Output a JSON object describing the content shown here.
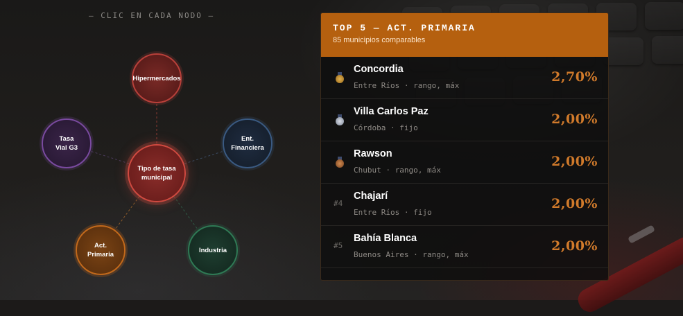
{
  "hint": "— CLIC EN CADA NODO —",
  "graph": {
    "center": {
      "label": "Tipo de tasa municipal"
    },
    "nodes": [
      {
        "key": "hiper",
        "label": "Hipermercados",
        "color": "#b8403a"
      },
      {
        "key": "ent",
        "label": "Ent. Financiera",
        "color": "#2e4a6e"
      },
      {
        "key": "ind",
        "label": "Industria",
        "color": "#2f7a55"
      },
      {
        "key": "act",
        "label": "Act. Primaria",
        "color": "#c2691b"
      },
      {
        "key": "tasa",
        "label": "Tasa Vial G3",
        "color": "#6a3a8c"
      }
    ]
  },
  "panel": {
    "title": "TOP 5 — ACT. PRIMARIA",
    "subtitle": "85 municipios comparables",
    "rows": [
      {
        "rank": "",
        "medal": "gold",
        "city": "Concordia",
        "meta": "Entre Ríos · rango, máx",
        "value": "2,70%"
      },
      {
        "rank": "",
        "medal": "silver",
        "city": "Villa Carlos Paz",
        "meta": "Córdoba · fijo",
        "value": "2,00%"
      },
      {
        "rank": "",
        "medal": "bronze",
        "city": "Rawson",
        "meta": "Chubut · rango, máx",
        "value": "2,00%"
      },
      {
        "rank": "#4",
        "medal": "",
        "city": "Chajarí",
        "meta": "Entre Ríos · fijo",
        "value": "2,00%"
      },
      {
        "rank": "#5",
        "medal": "",
        "city": "Bahía Blanca",
        "meta": "Buenos Aires · rango, máx",
        "value": "2,00%"
      }
    ]
  }
}
